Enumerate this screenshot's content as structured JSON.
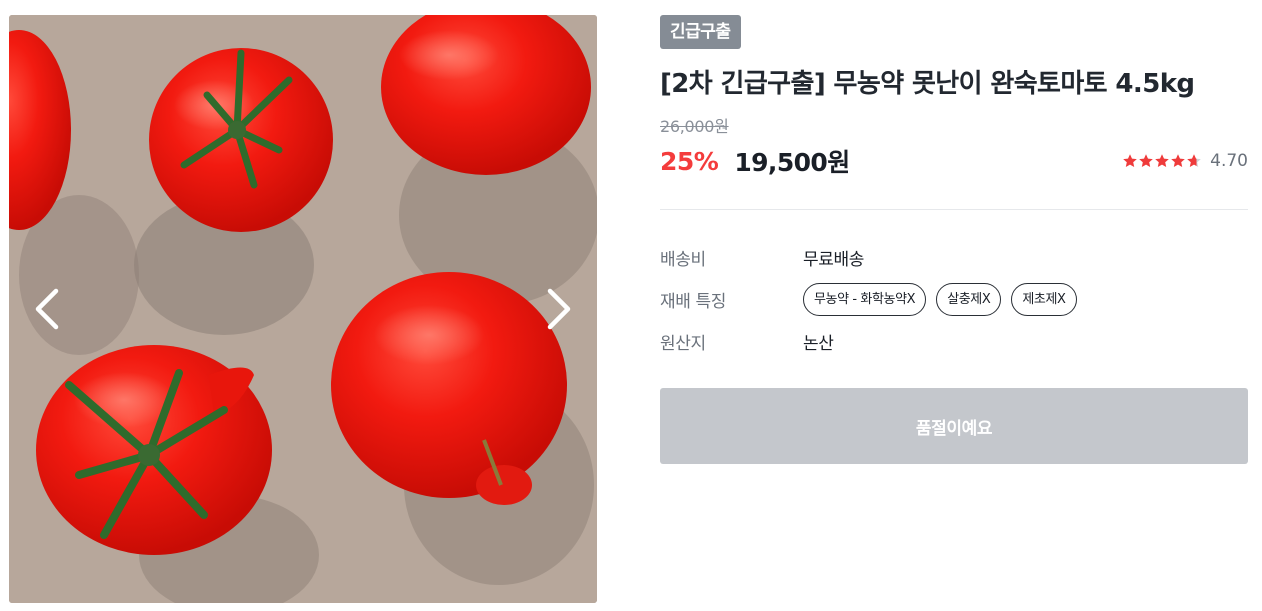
{
  "product": {
    "badge": "긴급구출",
    "title": "[2차 긴급구출] 무농약 못난이 완숙토마토 4.5kg",
    "original_price": "26,000원",
    "discount_rate": "25%",
    "sale_price": "19,500원",
    "rating": 4.7,
    "rating_text": "4.70"
  },
  "gallery": {
    "prev_icon": "chevron-left-icon",
    "next_icon": "chevron-right-icon"
  },
  "specs": {
    "shipping_label": "배송비",
    "shipping_value": "무료배송",
    "cultivation_label": "재배 특징",
    "cultivation_tags": [
      "무농약 - 화학농약X",
      "살충제X",
      "제초제X"
    ],
    "origin_label": "원산지",
    "origin_value": "논산"
  },
  "cta": {
    "soldout_label": "품절이예요"
  },
  "colors": {
    "accent_red": "#f43c3c",
    "badge_gray": "#858c95",
    "button_disabled": "#c4c7cc",
    "star_red": "#ef3b3b"
  }
}
